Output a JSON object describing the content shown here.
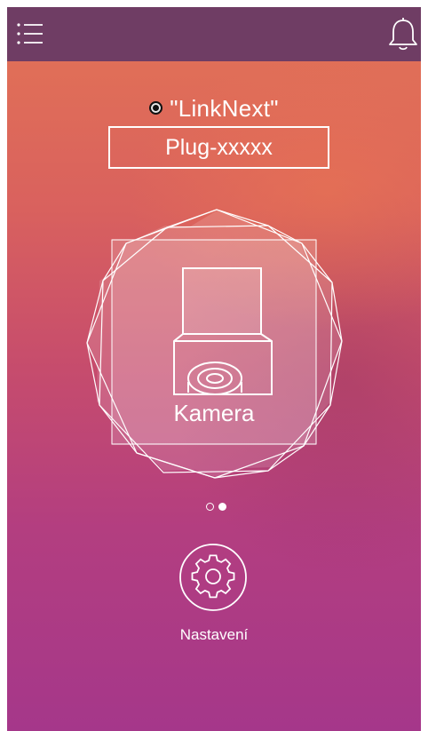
{
  "header": {
    "menu_icon": "list-menu-icon",
    "notification_icon": "bell-icon"
  },
  "network": {
    "status_icon": "radio-dot-icon",
    "name": "\"LinkNext\""
  },
  "device": {
    "id": "Plug-xxxxx",
    "type_label": "Kamera",
    "icon": "camera-icon"
  },
  "pager": {
    "count": 2,
    "active_index": 1
  },
  "settings": {
    "icon": "gear-icon",
    "label": "Nastavení"
  }
}
